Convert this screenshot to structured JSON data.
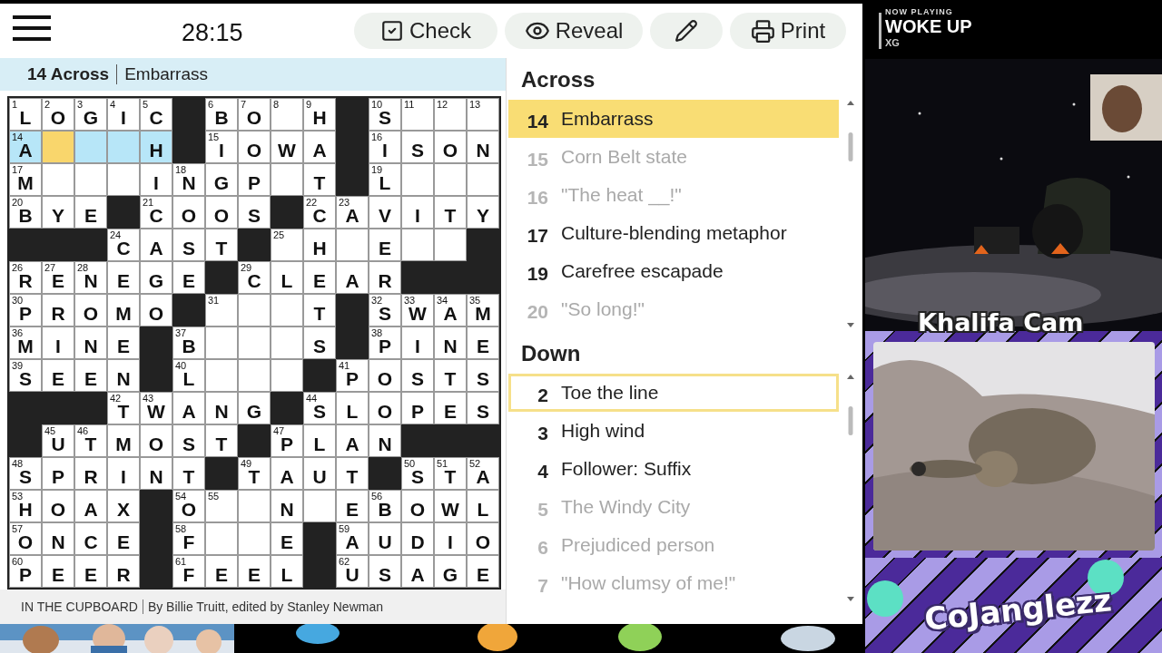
{
  "toolbar": {
    "timer": "28:15",
    "buttons": [
      {
        "kind": "check",
        "label": "Check"
      },
      {
        "kind": "reveal",
        "label": "Reveal"
      },
      {
        "kind": "pencil"
      },
      {
        "kind": "print",
        "label": "Print"
      }
    ]
  },
  "current_clue": {
    "ref": "14 Across",
    "text": "Embarrass"
  },
  "grid": {
    "rows": [
      [
        {
          "kind": "letter",
          "number": "1",
          "letter": "L",
          "selected": false,
          "in_word": false
        },
        {
          "kind": "letter",
          "number": "2",
          "letter": "O",
          "selected": false,
          "in_word": false
        },
        {
          "kind": "letter",
          "number": "3",
          "letter": "G",
          "selected": false,
          "in_word": false
        },
        {
          "kind": "letter",
          "number": "4",
          "letter": "I",
          "selected": false,
          "in_word": false
        },
        {
          "kind": "letter",
          "number": "5",
          "letter": "C",
          "selected": false,
          "in_word": false
        },
        {
          "kind": "block"
        },
        {
          "kind": "letter",
          "number": "6",
          "letter": "B",
          "selected": false,
          "in_word": false
        },
        {
          "kind": "letter",
          "number": "7",
          "letter": "O",
          "selected": false,
          "in_word": false
        },
        {
          "kind": "letter",
          "number": "8",
          "selected": false,
          "in_word": false
        },
        {
          "kind": "letter",
          "number": "9",
          "letter": "H",
          "selected": false,
          "in_word": false
        },
        {
          "kind": "block"
        },
        {
          "kind": "letter",
          "number": "10",
          "letter": "S",
          "selected": false,
          "in_word": false
        },
        {
          "kind": "letter",
          "number": "11",
          "selected": false,
          "in_word": false
        },
        {
          "kind": "letter",
          "number": "12",
          "selected": false,
          "in_word": false
        },
        {
          "kind": "letter",
          "number": "13",
          "selected": false,
          "in_word": false
        }
      ],
      [
        {
          "kind": "letter",
          "number": "14",
          "letter": "A",
          "selected": false,
          "in_word": true
        },
        {
          "kind": "letter",
          "selected": true,
          "in_word": true
        },
        {
          "kind": "letter",
          "selected": false,
          "in_word": true
        },
        {
          "kind": "letter",
          "selected": false,
          "in_word": true
        },
        {
          "kind": "letter",
          "letter": "H",
          "selected": false,
          "in_word": true
        },
        {
          "kind": "block"
        },
        {
          "kind": "letter",
          "number": "15",
          "letter": "I",
          "selected": false,
          "in_word": false
        },
        {
          "kind": "letter",
          "letter": "O",
          "selected": false,
          "in_word": false
        },
        {
          "kind": "letter",
          "letter": "W",
          "selected": false,
          "in_word": false
        },
        {
          "kind": "letter",
          "letter": "A",
          "selected": false,
          "in_word": false
        },
        {
          "kind": "block"
        },
        {
          "kind": "letter",
          "number": "16",
          "letter": "I",
          "selected": false,
          "in_word": false
        },
        {
          "kind": "letter",
          "letter": "S",
          "selected": false,
          "in_word": false
        },
        {
          "kind": "letter",
          "letter": "O",
          "selected": false,
          "in_word": false
        },
        {
          "kind": "letter",
          "letter": "N",
          "selected": false,
          "in_word": false
        }
      ],
      [
        {
          "kind": "letter",
          "number": "17",
          "letter": "M",
          "selected": false,
          "in_word": false
        },
        {
          "kind": "letter",
          "selected": false,
          "in_word": false
        },
        {
          "kind": "letter",
          "selected": false,
          "in_word": false
        },
        {
          "kind": "letter",
          "selected": false,
          "in_word": false
        },
        {
          "kind": "letter",
          "letter": "I",
          "selected": false,
          "in_word": false
        },
        {
          "kind": "letter",
          "number": "18",
          "letter": "N",
          "selected": false,
          "in_word": false
        },
        {
          "kind": "letter",
          "letter": "G",
          "selected": false,
          "in_word": false
        },
        {
          "kind": "letter",
          "letter": "P",
          "selected": false,
          "in_word": false
        },
        {
          "kind": "letter",
          "selected": false,
          "in_word": false
        },
        {
          "kind": "letter",
          "letter": "T",
          "selected": false,
          "in_word": false
        },
        {
          "kind": "block"
        },
        {
          "kind": "letter",
          "number": "19",
          "letter": "L",
          "selected": false,
          "in_word": false
        },
        {
          "kind": "letter",
          "selected": false,
          "in_word": false
        },
        {
          "kind": "letter",
          "selected": false,
          "in_word": false
        },
        {
          "kind": "letter",
          "selected": false,
          "in_word": false
        }
      ],
      [
        {
          "kind": "letter",
          "number": "20",
          "letter": "B",
          "selected": false,
          "in_word": false
        },
        {
          "kind": "letter",
          "letter": "Y",
          "selected": false,
          "in_word": false
        },
        {
          "kind": "letter",
          "letter": "E",
          "selected": false,
          "in_word": false
        },
        {
          "kind": "block"
        },
        {
          "kind": "letter",
          "number": "21",
          "letter": "C",
          "selected": false,
          "in_word": false
        },
        {
          "kind": "letter",
          "letter": "O",
          "selected": false,
          "in_word": false
        },
        {
          "kind": "letter",
          "letter": "O",
          "selected": false,
          "in_word": false
        },
        {
          "kind": "letter",
          "letter": "S",
          "selected": false,
          "in_word": false
        },
        {
          "kind": "block"
        },
        {
          "kind": "letter",
          "number": "22",
          "letter": "C",
          "selected": false,
          "in_word": false
        },
        {
          "kind": "letter",
          "number": "23",
          "letter": "A",
          "selected": false,
          "in_word": false
        },
        {
          "kind": "letter",
          "letter": "V",
          "selected": false,
          "in_word": false
        },
        {
          "kind": "letter",
          "letter": "I",
          "selected": false,
          "in_word": false
        },
        {
          "kind": "letter",
          "letter": "T",
          "selected": false,
          "in_word": false
        },
        {
          "kind": "letter",
          "letter": "Y",
          "selected": false,
          "in_word": false
        }
      ],
      [
        {
          "kind": "block"
        },
        {
          "kind": "block"
        },
        {
          "kind": "block"
        },
        {
          "kind": "letter",
          "number": "24",
          "letter": "C",
          "selected": false,
          "in_word": false
        },
        {
          "kind": "letter",
          "letter": "A",
          "selected": false,
          "in_word": false
        },
        {
          "kind": "letter",
          "letter": "S",
          "selected": false,
          "in_word": false
        },
        {
          "kind": "letter",
          "letter": "T",
          "selected": false,
          "in_word": false
        },
        {
          "kind": "block"
        },
        {
          "kind": "letter",
          "number": "25",
          "selected": false,
          "in_word": false
        },
        {
          "kind": "letter",
          "letter": "H",
          "selected": false,
          "in_word": false
        },
        {
          "kind": "letter",
          "selected": false,
          "in_word": false
        },
        {
          "kind": "letter",
          "letter": "E",
          "selected": false,
          "in_word": false
        },
        {
          "kind": "letter",
          "selected": false,
          "in_word": false
        },
        {
          "kind": "letter",
          "selected": false,
          "in_word": false
        },
        {
          "kind": "block"
        }
      ],
      [
        {
          "kind": "letter",
          "number": "26",
          "letter": "R",
          "selected": false,
          "in_word": false
        },
        {
          "kind": "letter",
          "number": "27",
          "letter": "E",
          "selected": false,
          "in_word": false
        },
        {
          "kind": "letter",
          "number": "28",
          "letter": "N",
          "selected": false,
          "in_word": false
        },
        {
          "kind": "letter",
          "letter": "E",
          "selected": false,
          "in_word": false
        },
        {
          "kind": "letter",
          "letter": "G",
          "selected": false,
          "in_word": false
        },
        {
          "kind": "letter",
          "letter": "E",
          "selected": false,
          "in_word": false
        },
        {
          "kind": "block"
        },
        {
          "kind": "letter",
          "number": "29",
          "letter": "C",
          "selected": false,
          "in_word": false
        },
        {
          "kind": "letter",
          "letter": "L",
          "selected": false,
          "in_word": false
        },
        {
          "kind": "letter",
          "letter": "E",
          "selected": false,
          "in_word": false
        },
        {
          "kind": "letter",
          "letter": "A",
          "selected": false,
          "in_word": false
        },
        {
          "kind": "letter",
          "letter": "R",
          "selected": false,
          "in_word": false
        },
        {
          "kind": "block"
        },
        {
          "kind": "block"
        },
        {
          "kind": "block"
        }
      ],
      [
        {
          "kind": "letter",
          "number": "30",
          "letter": "P",
          "selected": false,
          "in_word": false
        },
        {
          "kind": "letter",
          "letter": "R",
          "selected": false,
          "in_word": false
        },
        {
          "kind": "letter",
          "letter": "O",
          "selected": false,
          "in_word": false
        },
        {
          "kind": "letter",
          "letter": "M",
          "selected": false,
          "in_word": false
        },
        {
          "kind": "letter",
          "letter": "O",
          "selected": false,
          "in_word": false
        },
        {
          "kind": "block"
        },
        {
          "kind": "letter",
          "number": "31",
          "selected": false,
          "in_word": false
        },
        {
          "kind": "letter",
          "selected": false,
          "in_word": false
        },
        {
          "kind": "letter",
          "selected": false,
          "in_word": false
        },
        {
          "kind": "letter",
          "letter": "T",
          "selected": false,
          "in_word": false
        },
        {
          "kind": "block"
        },
        {
          "kind": "letter",
          "number": "32",
          "letter": "S",
          "selected": false,
          "in_word": false
        },
        {
          "kind": "letter",
          "number": "33",
          "letter": "W",
          "selected": false,
          "in_word": false
        },
        {
          "kind": "letter",
          "number": "34",
          "letter": "A",
          "selected": false,
          "in_word": false
        },
        {
          "kind": "letter",
          "number": "35",
          "letter": "M",
          "selected": false,
          "in_word": false
        }
      ],
      [
        {
          "kind": "letter",
          "number": "36",
          "letter": "M",
          "selected": false,
          "in_word": false
        },
        {
          "kind": "letter",
          "letter": "I",
          "selected": false,
          "in_word": false
        },
        {
          "kind": "letter",
          "letter": "N",
          "selected": false,
          "in_word": false
        },
        {
          "kind": "letter",
          "letter": "E",
          "selected": false,
          "in_word": false
        },
        {
          "kind": "block"
        },
        {
          "kind": "letter",
          "number": "37",
          "letter": "B",
          "selected": false,
          "in_word": false
        },
        {
          "kind": "letter",
          "selected": false,
          "in_word": false
        },
        {
          "kind": "letter",
          "selected": false,
          "in_word": false
        },
        {
          "kind": "letter",
          "selected": false,
          "in_word": false
        },
        {
          "kind": "letter",
          "letter": "S",
          "selected": false,
          "in_word": false
        },
        {
          "kind": "block"
        },
        {
          "kind": "letter",
          "number": "38",
          "letter": "P",
          "selected": false,
          "in_word": false
        },
        {
          "kind": "letter",
          "letter": "I",
          "selected": false,
          "in_word": false
        },
        {
          "kind": "letter",
          "letter": "N",
          "selected": false,
          "in_word": false
        },
        {
          "kind": "letter",
          "letter": "E",
          "selected": false,
          "in_word": false
        }
      ],
      [
        {
          "kind": "letter",
          "number": "39",
          "letter": "S",
          "selected": false,
          "in_word": false
        },
        {
          "kind": "letter",
          "letter": "E",
          "selected": false,
          "in_word": false
        },
        {
          "kind": "letter",
          "letter": "E",
          "selected": false,
          "in_word": false
        },
        {
          "kind": "letter",
          "letter": "N",
          "selected": false,
          "in_word": false
        },
        {
          "kind": "block"
        },
        {
          "kind": "letter",
          "number": "40",
          "letter": "L",
          "selected": false,
          "in_word": false
        },
        {
          "kind": "letter",
          "selected": false,
          "in_word": false
        },
        {
          "kind": "letter",
          "selected": false,
          "in_word": false
        },
        {
          "kind": "letter",
          "selected": false,
          "in_word": false
        },
        {
          "kind": "block"
        },
        {
          "kind": "letter",
          "number": "41",
          "letter": "P",
          "selected": false,
          "in_word": false
        },
        {
          "kind": "letter",
          "letter": "O",
          "selected": false,
          "in_word": false
        },
        {
          "kind": "letter",
          "letter": "S",
          "selected": false,
          "in_word": false
        },
        {
          "kind": "letter",
          "letter": "T",
          "selected": false,
          "in_word": false
        },
        {
          "kind": "letter",
          "letter": "S",
          "selected": false,
          "in_word": false
        }
      ],
      [
        {
          "kind": "block"
        },
        {
          "kind": "block"
        },
        {
          "kind": "block"
        },
        {
          "kind": "letter",
          "number": "42",
          "letter": "T",
          "selected": false,
          "in_word": false
        },
        {
          "kind": "letter",
          "number": "43",
          "letter": "W",
          "selected": false,
          "in_word": false
        },
        {
          "kind": "letter",
          "letter": "A",
          "selected": false,
          "in_word": false
        },
        {
          "kind": "letter",
          "letter": "N",
          "selected": false,
          "in_word": false
        },
        {
          "kind": "letter",
          "letter": "G",
          "selected": false,
          "in_word": false
        },
        {
          "kind": "block"
        },
        {
          "kind": "letter",
          "number": "44",
          "letter": "S",
          "selected": false,
          "in_word": false
        },
        {
          "kind": "letter",
          "letter": "L",
          "selected": false,
          "in_word": false
        },
        {
          "kind": "letter",
          "letter": "O",
          "selected": false,
          "in_word": false
        },
        {
          "kind": "letter",
          "letter": "P",
          "selected": false,
          "in_word": false
        },
        {
          "kind": "letter",
          "letter": "E",
          "selected": false,
          "in_word": false
        },
        {
          "kind": "letter",
          "letter": "S",
          "selected": false,
          "in_word": false
        }
      ],
      [
        {
          "kind": "block"
        },
        {
          "kind": "letter",
          "number": "45",
          "letter": "U",
          "selected": false,
          "in_word": false
        },
        {
          "kind": "letter",
          "number": "46",
          "letter": "T",
          "selected": false,
          "in_word": false
        },
        {
          "kind": "letter",
          "letter": "M",
          "selected": false,
          "in_word": false
        },
        {
          "kind": "letter",
          "letter": "O",
          "selected": false,
          "in_word": false
        },
        {
          "kind": "letter",
          "letter": "S",
          "selected": false,
          "in_word": false
        },
        {
          "kind": "letter",
          "letter": "T",
          "selected": false,
          "in_word": false
        },
        {
          "kind": "block"
        },
        {
          "kind": "letter",
          "number": "47",
          "letter": "P",
          "selected": false,
          "in_word": false
        },
        {
          "kind": "letter",
          "letter": "L",
          "selected": false,
          "in_word": false
        },
        {
          "kind": "letter",
          "letter": "A",
          "selected": false,
          "in_word": false
        },
        {
          "kind": "letter",
          "letter": "N",
          "selected": false,
          "in_word": false
        },
        {
          "kind": "block"
        },
        {
          "kind": "block"
        },
        {
          "kind": "block"
        }
      ],
      [
        {
          "kind": "letter",
          "number": "48",
          "letter": "S",
          "selected": false,
          "in_word": false
        },
        {
          "kind": "letter",
          "letter": "P",
          "selected": false,
          "in_word": false
        },
        {
          "kind": "letter",
          "letter": "R",
          "selected": false,
          "in_word": false
        },
        {
          "kind": "letter",
          "letter": "I",
          "selected": false,
          "in_word": false
        },
        {
          "kind": "letter",
          "letter": "N",
          "selected": false,
          "in_word": false
        },
        {
          "kind": "letter",
          "letter": "T",
          "selected": false,
          "in_word": false
        },
        {
          "kind": "block"
        },
        {
          "kind": "letter",
          "number": "49",
          "letter": "T",
          "selected": false,
          "in_word": false
        },
        {
          "kind": "letter",
          "letter": "A",
          "selected": false,
          "in_word": false
        },
        {
          "kind": "letter",
          "letter": "U",
          "selected": false,
          "in_word": false
        },
        {
          "kind": "letter",
          "letter": "T",
          "selected": false,
          "in_word": false
        },
        {
          "kind": "block"
        },
        {
          "kind": "letter",
          "number": "50",
          "letter": "S",
          "selected": false,
          "in_word": false
        },
        {
          "kind": "letter",
          "number": "51",
          "letter": "T",
          "selected": false,
          "in_word": false
        },
        {
          "kind": "letter",
          "number": "52",
          "letter": "A",
          "selected": false,
          "in_word": false
        }
      ],
      [
        {
          "kind": "letter",
          "number": "53",
          "letter": "H",
          "selected": false,
          "in_word": false
        },
        {
          "kind": "letter",
          "letter": "O",
          "selected": false,
          "in_word": false
        },
        {
          "kind": "letter",
          "letter": "A",
          "selected": false,
          "in_word": false
        },
        {
          "kind": "letter",
          "letter": "X",
          "selected": false,
          "in_word": false
        },
        {
          "kind": "block"
        },
        {
          "kind": "letter",
          "number": "54",
          "letter": "O",
          "selected": false,
          "in_word": false
        },
        {
          "kind": "letter",
          "number": "55",
          "selected": false,
          "in_word": false
        },
        {
          "kind": "letter",
          "selected": false,
          "in_word": false
        },
        {
          "kind": "letter",
          "letter": "N",
          "selected": false,
          "in_word": false
        },
        {
          "kind": "letter",
          "selected": false,
          "in_word": false
        },
        {
          "kind": "letter",
          "letter": "E",
          "selected": false,
          "in_word": false
        },
        {
          "kind": "letter",
          "number": "56",
          "letter": "B",
          "selected": false,
          "in_word": false
        },
        {
          "kind": "letter",
          "letter": "O",
          "selected": false,
          "in_word": false
        },
        {
          "kind": "letter",
          "letter": "W",
          "selected": false,
          "in_word": false
        },
        {
          "kind": "letter",
          "letter": "L",
          "selected": false,
          "in_word": false
        }
      ],
      [
        {
          "kind": "letter",
          "number": "57",
          "letter": "O",
          "selected": false,
          "in_word": false
        },
        {
          "kind": "letter",
          "letter": "N",
          "selected": false,
          "in_word": false
        },
        {
          "kind": "letter",
          "letter": "C",
          "selected": false,
          "in_word": false
        },
        {
          "kind": "letter",
          "letter": "E",
          "selected": false,
          "in_word": false
        },
        {
          "kind": "block"
        },
        {
          "kind": "letter",
          "number": "58",
          "letter": "F",
          "selected": false,
          "in_word": false
        },
        {
          "kind": "letter",
          "selected": false,
          "in_word": false
        },
        {
          "kind": "letter",
          "selected": false,
          "in_word": false
        },
        {
          "kind": "letter",
          "letter": "E",
          "selected": false,
          "in_word": false
        },
        {
          "kind": "block"
        },
        {
          "kind": "letter",
          "number": "59",
          "letter": "A",
          "selected": false,
          "in_word": false
        },
        {
          "kind": "letter",
          "letter": "U",
          "selected": false,
          "in_word": false
        },
        {
          "kind": "letter",
          "letter": "D",
          "selected": false,
          "in_word": false
        },
        {
          "kind": "letter",
          "letter": "I",
          "selected": false,
          "in_word": false
        },
        {
          "kind": "letter",
          "letter": "O",
          "selected": false,
          "in_word": false
        }
      ],
      [
        {
          "kind": "letter",
          "number": "60",
          "letter": "P",
          "selected": false,
          "in_word": false
        },
        {
          "kind": "letter",
          "letter": "E",
          "selected": false,
          "in_word": false
        },
        {
          "kind": "letter",
          "letter": "E",
          "selected": false,
          "in_word": false
        },
        {
          "kind": "letter",
          "letter": "R",
          "selected": false,
          "in_word": false
        },
        {
          "kind": "block"
        },
        {
          "kind": "letter",
          "number": "61",
          "letter": "F",
          "selected": false,
          "in_word": false
        },
        {
          "kind": "letter",
          "letter": "E",
          "selected": false,
          "in_word": false
        },
        {
          "kind": "letter",
          "letter": "E",
          "selected": false,
          "in_word": false
        },
        {
          "kind": "letter",
          "letter": "L",
          "selected": false,
          "in_word": false
        },
        {
          "kind": "block"
        },
        {
          "kind": "letter",
          "number": "62",
          "letter": "U",
          "selected": false,
          "in_word": false
        },
        {
          "kind": "letter",
          "letter": "S",
          "selected": false,
          "in_word": false
        },
        {
          "kind": "letter",
          "letter": "A",
          "selected": false,
          "in_word": false
        },
        {
          "kind": "letter",
          "letter": "G",
          "selected": false,
          "in_word": false
        },
        {
          "kind": "letter",
          "letter": "E",
          "selected": false,
          "in_word": false
        }
      ]
    ]
  },
  "byline": {
    "title": "IN THE CUPBOARD",
    "credit": "By Billie Truitt, edited by Stanley Newman"
  },
  "clue_lists": [
    {
      "title": "Across",
      "clues": [
        {
          "number": "14",
          "text": "Embarrass",
          "selected": true,
          "crossing": false,
          "done": false
        },
        {
          "number": "15",
          "text": "Corn Belt state",
          "selected": false,
          "crossing": false,
          "done": true
        },
        {
          "number": "16",
          "text": "\"The heat __!\"",
          "selected": false,
          "crossing": false,
          "done": true
        },
        {
          "number": "17",
          "text": "Culture-blending metaphor",
          "selected": false,
          "crossing": false,
          "done": false
        },
        {
          "number": "19",
          "text": "Carefree escapade",
          "selected": false,
          "crossing": false,
          "done": false
        },
        {
          "number": "20",
          "text": "\"So long!\"",
          "selected": false,
          "crossing": false,
          "done": true
        }
      ]
    },
    {
      "title": "Down",
      "clues": [
        {
          "number": "2",
          "text": "Toe the line",
          "selected": false,
          "crossing": true,
          "done": false
        },
        {
          "number": "3",
          "text": "High wind",
          "selected": false,
          "crossing": false,
          "done": false
        },
        {
          "number": "4",
          "text": "Follower: Suffix",
          "selected": false,
          "crossing": false,
          "done": false
        },
        {
          "number": "5",
          "text": "The Windy City",
          "selected": false,
          "crossing": false,
          "done": true
        },
        {
          "number": "6",
          "text": "Prejudiced person",
          "selected": false,
          "crossing": false,
          "done": true
        },
        {
          "number": "7",
          "text": "\"How clumsy of me!\"",
          "selected": false,
          "crossing": false,
          "done": true
        }
      ]
    }
  ],
  "now_playing": {
    "label": "NOW PLAYING",
    "title": "WOKE UP",
    "artist": "XG"
  },
  "cam_label": "Khalifa Cam",
  "channel_name": "CoJanglezz"
}
